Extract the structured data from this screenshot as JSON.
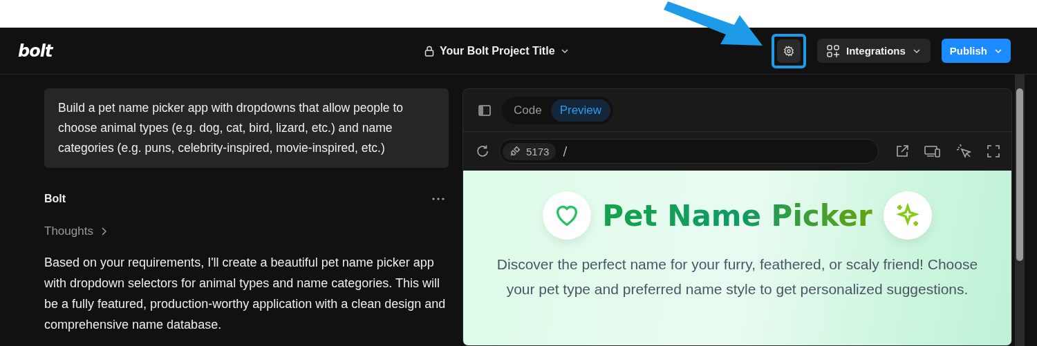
{
  "header": {
    "logo": "bolt",
    "project_title": "Your Bolt Project Title",
    "integrations": "Integrations",
    "publish": "Publish",
    "settings_highlighted": true
  },
  "chat": {
    "user_message": "Build a pet name picker app with dropdowns that allow people to choose animal types (e.g. dog, cat, bird, lizard, etc.) and name categories (e.g. puns, celebrity-inspired, movie-inspired, etc.)",
    "assistant_name": "Bolt",
    "thoughts": "Thoughts",
    "thoughts_expanded": false,
    "response": "Based on your requirements, I'll create a beautiful pet name picker app with dropdown selectors for animal types and name categories. This will be a fully featured, production-worthy application with a clean design and comprehensive name database."
  },
  "workbench": {
    "tabs": [
      {
        "label": "Code",
        "selected": false
      },
      {
        "label": "Preview",
        "selected": true
      }
    ],
    "port": "5173",
    "path": "/"
  },
  "preview": {
    "title": "Pet Name Picker",
    "description": "Discover the perfect name for your furry, feathered, or scaly friend! Choose your pet type and preferred name style to get personalized suggestions."
  }
}
